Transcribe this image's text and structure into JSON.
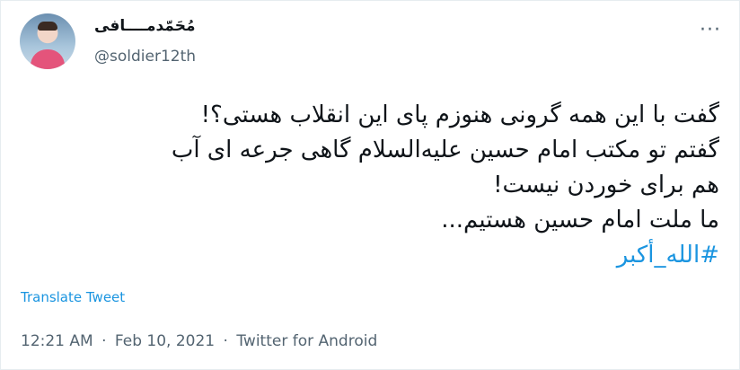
{
  "author": {
    "display_name": "مُحَمّدمــــافی",
    "handle": "@soldier12th"
  },
  "tweet": {
    "lines": [
      "گفت با این همه گرونی هنوزم پای این انقلاب هستی؟!",
      "گفتم تو مکتب امام حسین علیه‌السلام گاهی جرعه ای آب",
      "هم برای خوردن نیست!",
      "ما ملت امام حسین هستیم..."
    ],
    "hashtag": "#الله_أکبر"
  },
  "translate_label": "Translate Tweet",
  "meta": {
    "time": "12:21 AM",
    "date": "Feb 10, 2021",
    "source": "Twitter for Android",
    "separator": "·"
  },
  "icons": {
    "more": "more-dots-icon"
  },
  "colors": {
    "link": "#1b95e0",
    "secondary": "#536471",
    "text": "#0f1419"
  }
}
